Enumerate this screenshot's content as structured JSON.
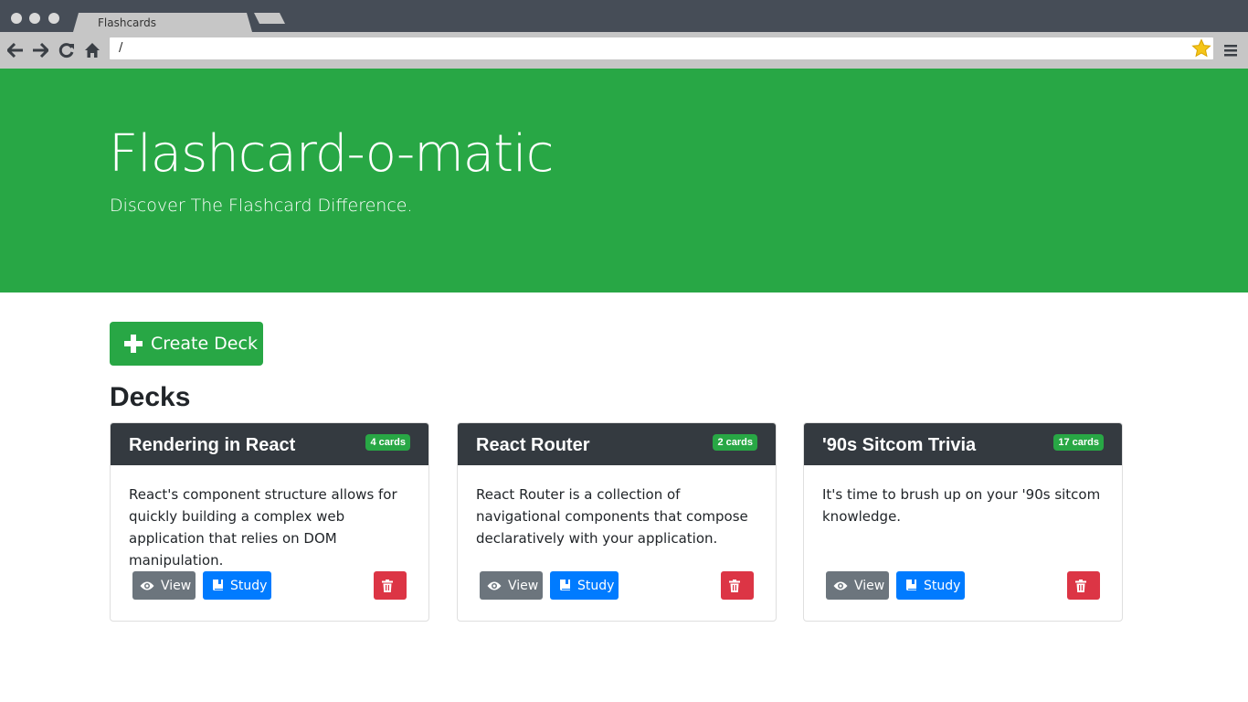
{
  "browser": {
    "tab_title": "Flashcards",
    "url": "/"
  },
  "hero": {
    "title": "Flashcard-o-matic",
    "subtitle": "Discover The Flashcard Difference."
  },
  "main": {
    "create_button_label": "Create Deck",
    "decks_heading": "Decks"
  },
  "decks": [
    {
      "name": "Rendering in React",
      "card_count": "4 cards",
      "description": "React's component structure allows for quickly building a complex web application that relies on DOM manipulation.",
      "view_label": "View",
      "study_label": "Study"
    },
    {
      "name": "React Router",
      "card_count": "2 cards",
      "description": "React Router is a collection of navigational components that compose declaratively with your application.",
      "view_label": "View",
      "study_label": "Study"
    },
    {
      "name": "'90s Sitcom Trivia",
      "card_count": "17 cards",
      "description": "It's time to brush up on your '90s sitcom knowledge.",
      "view_label": "View",
      "study_label": "Study"
    }
  ],
  "colors": {
    "primary_green": "#28a745",
    "header_dark": "#343a40",
    "study_blue": "#007bff",
    "view_gray": "#6c757d",
    "delete_red": "#dc3545"
  },
  "icons": {
    "back": "arrow-left-icon",
    "forward": "arrow-right-icon",
    "reload": "reload-icon",
    "home": "home-icon",
    "bookmark": "star-icon",
    "menu": "hamburger-menu-icon",
    "create": "plus-icon",
    "view": "eye-icon",
    "study": "book-icon",
    "delete": "trash-icon"
  }
}
